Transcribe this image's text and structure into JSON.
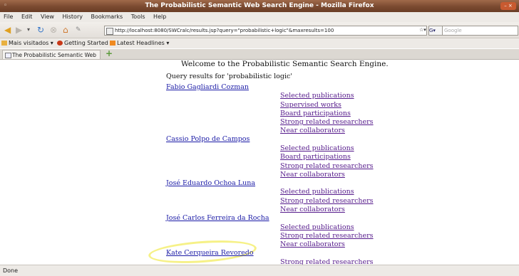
{
  "window": {
    "title": "The Probabilistic Semantic Web Search Engine - Mozilla Firefox"
  },
  "menu": [
    "File",
    "Edit",
    "View",
    "History",
    "Bookmarks",
    "Tools",
    "Help"
  ],
  "nav": {
    "url": "http://localhost:8080/SWCralc/results.jsp?query=\"probabilistic+logic\"&maxresults=100",
    "search_placeholder": "Google"
  },
  "bookmarks": [
    "Mais visitados",
    "Getting Started",
    "Latest Headlines"
  ],
  "tab": {
    "title": "The Probabilistic Semantic Web ..."
  },
  "page": {
    "welcome": "Welcome to the Probabilistic Semantic Search Engine.",
    "query_line": "Query results for 'probabilistic logic'",
    "researchers": [
      {
        "name": "Fabio Gagliardi Cozman",
        "links": [
          "Selected publications",
          "Supervised works",
          "Board participations",
          "Strong related researchers",
          "Near collaborators"
        ]
      },
      {
        "name": "Cassio Polpo de Campos",
        "links": [
          "Selected publications",
          "Board participations",
          "Strong related researchers",
          "Near collaborators"
        ]
      },
      {
        "name": "José Eduardo Ochoa Luna",
        "links": [
          "Selected publications",
          "Strong related researchers",
          "Near collaborators"
        ]
      },
      {
        "name": "José Carlos Ferreira da Rocha",
        "links": [
          "Selected publications",
          "Strong related researchers",
          "Near collaborators"
        ]
      },
      {
        "name": "Kate Cerqueira Revoredo",
        "links": [
          "Strong related researchers"
        ]
      }
    ]
  },
  "status": {
    "text": "Done"
  }
}
